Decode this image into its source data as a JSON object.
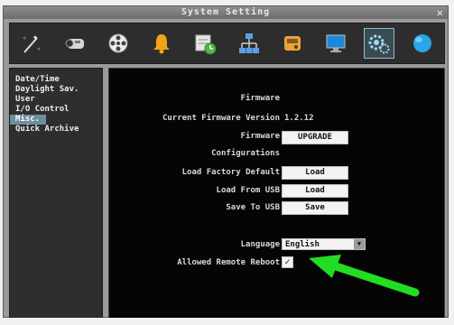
{
  "window": {
    "title": "System Setting",
    "close_glyph": "✕"
  },
  "toolbar": {
    "icons": [
      "magic-wand-icon",
      "camera-icon",
      "film-reel-icon",
      "alarm-bell-icon",
      "schedule-icon",
      "network-icon",
      "disk-icon",
      "monitor-icon",
      "system-settings-icon",
      "globe-icon"
    ],
    "active_icon": "system-settings-icon"
  },
  "sidebar": {
    "items": [
      {
        "label": "Date/Time"
      },
      {
        "label": "Daylight Sav."
      },
      {
        "label": "User"
      },
      {
        "label": "I/O Control"
      },
      {
        "label": "Misc."
      },
      {
        "label": "Quick Archive"
      }
    ],
    "selected": "Misc."
  },
  "main": {
    "firmware_heading": "Firmware",
    "current_firmware_label": "Current Firmware Version",
    "current_firmware_value": "1.2.12",
    "firmware_label": "Firmware",
    "upgrade_button": "UPGRADE",
    "configurations_heading": "Configurations",
    "load_factory_label": "Load Factory Default",
    "load_factory_button": "Load",
    "load_usb_label": "Load From USB",
    "load_usb_button": "Load",
    "save_usb_label": "Save To USB",
    "save_usb_button": "Save",
    "language_label": "Language",
    "language_value": "English",
    "dropdown_glyph": "▼",
    "remote_reboot_label": "Allowed Remote Reboot",
    "remote_reboot_checked": true,
    "checkmark_glyph": "✓"
  },
  "colors": {
    "annotation_arrow": "#22dd22",
    "selected_item": "#6f8f9e",
    "panel_background": "#050505"
  }
}
